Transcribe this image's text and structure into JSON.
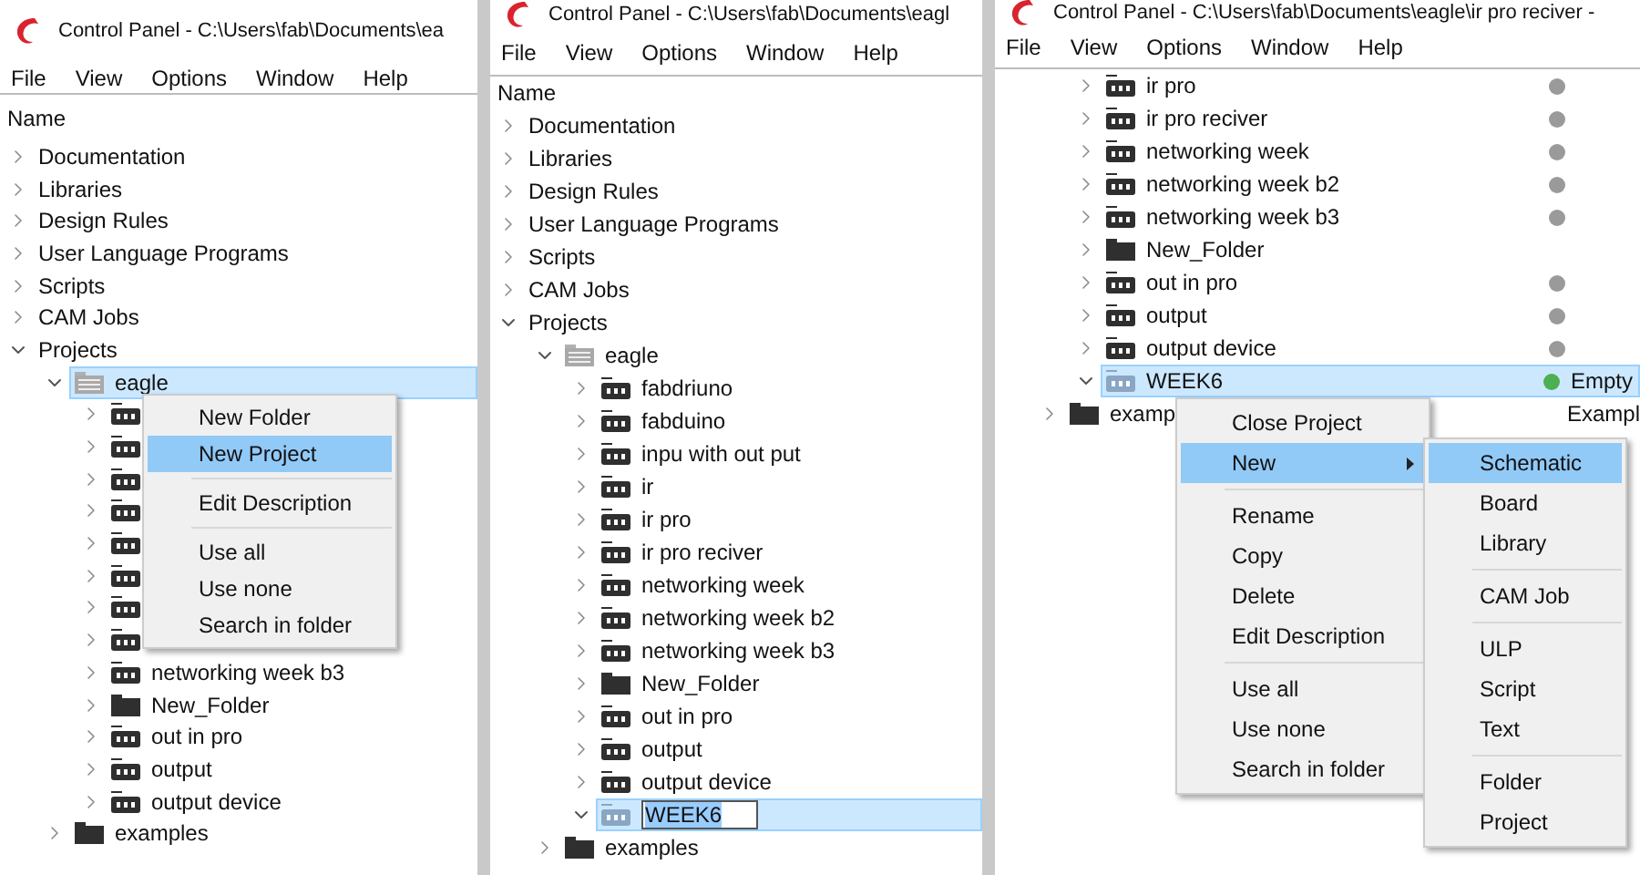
{
  "panes": [
    {
      "title": "Control Panel - C:\\Users\\fab\\Documents\\ea",
      "menu": [
        "File",
        "View",
        "Options",
        "Window",
        "Help"
      ],
      "header": "Name",
      "tree": [
        {
          "label": "Documentation",
          "kind": "category",
          "expanded": false,
          "selected": false
        },
        {
          "label": "Libraries",
          "kind": "category",
          "expanded": false,
          "selected": false
        },
        {
          "label": "Design Rules",
          "kind": "category",
          "expanded": false,
          "selected": false
        },
        {
          "label": "User Language Programs",
          "kind": "category",
          "expanded": false,
          "selected": false
        },
        {
          "label": "Scripts",
          "kind": "category",
          "expanded": false,
          "selected": false
        },
        {
          "label": "CAM Jobs",
          "kind": "category",
          "expanded": false,
          "selected": false
        },
        {
          "label": "Projects",
          "kind": "category",
          "expanded": true,
          "selected": false,
          "children": [
            {
              "label": "eagle",
              "kind": "workspace",
              "expanded": true,
              "selected": true,
              "children": [
                {
                  "kind": "project",
                  "expanded": false,
                  "selected": false
                },
                {
                  "kind": "project",
                  "expanded": false,
                  "selected": false
                },
                {
                  "kind": "project",
                  "expanded": false,
                  "selected": false
                },
                {
                  "kind": "project",
                  "expanded": false,
                  "selected": false
                },
                {
                  "kind": "project",
                  "expanded": false,
                  "selected": false
                },
                {
                  "kind": "project",
                  "expanded": false,
                  "selected": false
                },
                {
                  "kind": "project",
                  "expanded": false,
                  "selected": false
                },
                {
                  "kind": "project",
                  "expanded": false,
                  "selected": false
                },
                {
                  "label": "networking week b3",
                  "kind": "project",
                  "expanded": false,
                  "selected": false
                },
                {
                  "label": "New_Folder",
                  "kind": "folder",
                  "expanded": false,
                  "selected": false
                },
                {
                  "label": "out in pro",
                  "kind": "project",
                  "expanded": false,
                  "selected": false
                },
                {
                  "label": "output",
                  "kind": "project",
                  "expanded": false,
                  "selected": false
                },
                {
                  "label": "output device",
                  "kind": "project",
                  "expanded": false,
                  "selected": false
                }
              ]
            },
            {
              "label": "examples",
              "kind": "folder",
              "expanded": false,
              "selected": false
            }
          ]
        }
      ],
      "context_menu": {
        "items": [
          {
            "kind": "item",
            "label": "New Folder",
            "selected": false
          },
          {
            "kind": "item",
            "label": "New Project",
            "selected": true
          },
          {
            "kind": "separator"
          },
          {
            "kind": "item",
            "label": "Edit Description",
            "selected": false
          },
          {
            "kind": "separator"
          },
          {
            "kind": "item",
            "label": "Use all",
            "selected": false
          },
          {
            "kind": "item",
            "label": "Use none",
            "selected": false
          },
          {
            "kind": "item",
            "label": "Search in folder",
            "selected": false
          }
        ]
      }
    },
    {
      "title": "Control Panel - C:\\Users\\fab\\Documents\\eagl",
      "menu": [
        "File",
        "View",
        "Options",
        "Window",
        "Help"
      ],
      "header": "Name",
      "tree": [
        {
          "label": "Documentation",
          "kind": "category",
          "expanded": false,
          "selected": false
        },
        {
          "label": "Libraries",
          "kind": "category",
          "expanded": false,
          "selected": false
        },
        {
          "label": "Design Rules",
          "kind": "category",
          "expanded": false,
          "selected": false
        },
        {
          "label": "User Language Programs",
          "kind": "category",
          "expanded": false,
          "selected": false
        },
        {
          "label": "Scripts",
          "kind": "category",
          "expanded": false,
          "selected": false
        },
        {
          "label": "CAM Jobs",
          "kind": "category",
          "expanded": false,
          "selected": false
        },
        {
          "label": "Projects",
          "kind": "category",
          "expanded": true,
          "selected": false,
          "children": [
            {
              "label": "eagle",
              "kind": "workspace",
              "expanded": true,
              "selected": false,
              "children": [
                {
                  "label": "fabdriuno",
                  "kind": "project",
                  "expanded": false,
                  "selected": false
                },
                {
                  "label": "fabduino",
                  "kind": "project",
                  "expanded": false,
                  "selected": false
                },
                {
                  "label": "inpu with out put",
                  "kind": "project",
                  "expanded": false,
                  "selected": false
                },
                {
                  "label": "ir",
                  "kind": "project",
                  "expanded": false,
                  "selected": false
                },
                {
                  "label": "ir pro",
                  "kind": "project",
                  "expanded": false,
                  "selected": false
                },
                {
                  "label": "ir pro reciver",
                  "kind": "project",
                  "expanded": false,
                  "selected": false
                },
                {
                  "label": "networking week",
                  "kind": "project",
                  "expanded": false,
                  "selected": false
                },
                {
                  "label": "networking week b2",
                  "kind": "project",
                  "expanded": false,
                  "selected": false
                },
                {
                  "label": "networking week b3",
                  "kind": "project",
                  "expanded": false,
                  "selected": false
                },
                {
                  "label": "New_Folder",
                  "kind": "folder",
                  "expanded": false,
                  "selected": false
                },
                {
                  "label": "out in pro",
                  "kind": "project",
                  "expanded": false,
                  "selected": false
                },
                {
                  "label": "output",
                  "kind": "project",
                  "expanded": false,
                  "selected": false
                },
                {
                  "label": "output device",
                  "kind": "project",
                  "expanded": false,
                  "selected": false
                },
                {
                  "label": "WEEK6",
                  "kind": "open_project",
                  "expanded": true,
                  "selected": true,
                  "editing": true
                }
              ]
            },
            {
              "label": "examples",
              "kind": "folder",
              "expanded": false,
              "selected": false
            }
          ]
        }
      ]
    },
    {
      "title": "Control Panel - C:\\Users\\fab\\Documents\\eagle\\ir pro reciver -",
      "menu": [
        "File",
        "View",
        "Options",
        "Window",
        "Help"
      ],
      "tree": [
        {
          "children": [
            {
              "children": [
                {
                  "label": "ir pro",
                  "kind": "project",
                  "expanded": false,
                  "selected": false,
                  "status": {
                    "color": "#9a9a9a"
                  }
                },
                {
                  "label": "ir pro reciver",
                  "kind": "project",
                  "expanded": false,
                  "selected": false,
                  "status": {
                    "color": "#9a9a9a"
                  }
                },
                {
                  "label": "networking week",
                  "kind": "project",
                  "expanded": false,
                  "selected": false,
                  "status": {
                    "color": "#9a9a9a"
                  }
                },
                {
                  "label": "networking week b2",
                  "kind": "project",
                  "expanded": false,
                  "selected": false,
                  "status": {
                    "color": "#9a9a9a"
                  }
                },
                {
                  "label": "networking week b3",
                  "kind": "project",
                  "expanded": false,
                  "selected": false,
                  "status": {
                    "color": "#9a9a9a"
                  }
                },
                {
                  "label": "New_Folder",
                  "kind": "folder",
                  "expanded": false,
                  "selected": false
                },
                {
                  "label": "out in pro",
                  "kind": "project",
                  "expanded": false,
                  "selected": false,
                  "status": {
                    "color": "#9a9a9a"
                  }
                },
                {
                  "label": "output",
                  "kind": "project",
                  "expanded": false,
                  "selected": false,
                  "status": {
                    "color": "#9a9a9a"
                  }
                },
                {
                  "label": "output device",
                  "kind": "project",
                  "expanded": false,
                  "selected": false,
                  "status": {
                    "color": "#9a9a9a"
                  }
                },
                {
                  "label": "WEEK6",
                  "kind": "open_project",
                  "expanded": true,
                  "selected": true,
                  "status": {
                    "color": "#4caf50",
                    "text": "Empty"
                  }
                }
              ]
            },
            {
              "label": "examp",
              "kind": "folder",
              "expanded": false,
              "selected": false,
              "status": {
                "text": "Exampl"
              }
            }
          ]
        }
      ],
      "context_menu": {
        "items": [
          {
            "kind": "item",
            "label": "Close Project",
            "selected": false
          },
          {
            "kind": "item",
            "label": "New",
            "selected": true,
            "submenu": [
              {
                "kind": "item",
                "label": "Schematic",
                "selected": true
              },
              {
                "kind": "item",
                "label": "Board",
                "selected": false
              },
              {
                "kind": "item",
                "label": "Library",
                "selected": false
              },
              {
                "kind": "separator"
              },
              {
                "kind": "item",
                "label": "CAM Job",
                "selected": false
              },
              {
                "kind": "separator"
              },
              {
                "kind": "item",
                "label": "ULP",
                "selected": false
              },
              {
                "kind": "item",
                "label": "Script",
                "selected": false
              },
              {
                "kind": "item",
                "label": "Text",
                "selected": false
              },
              {
                "kind": "separator"
              },
              {
                "kind": "item",
                "label": "Folder",
                "selected": false
              },
              {
                "kind": "item",
                "label": "Project",
                "selected": false
              }
            ]
          },
          {
            "kind": "separator"
          },
          {
            "kind": "item",
            "label": "Rename",
            "selected": false
          },
          {
            "kind": "item",
            "label": "Copy",
            "selected": false
          },
          {
            "kind": "item",
            "label": "Delete",
            "selected": false
          },
          {
            "kind": "item",
            "label": "Edit Description",
            "selected": false
          },
          {
            "kind": "separator"
          },
          {
            "kind": "item",
            "label": "Use all",
            "selected": false
          },
          {
            "kind": "item",
            "label": "Use none",
            "selected": false
          },
          {
            "kind": "item",
            "label": "Search in folder",
            "selected": false
          }
        ]
      }
    }
  ]
}
